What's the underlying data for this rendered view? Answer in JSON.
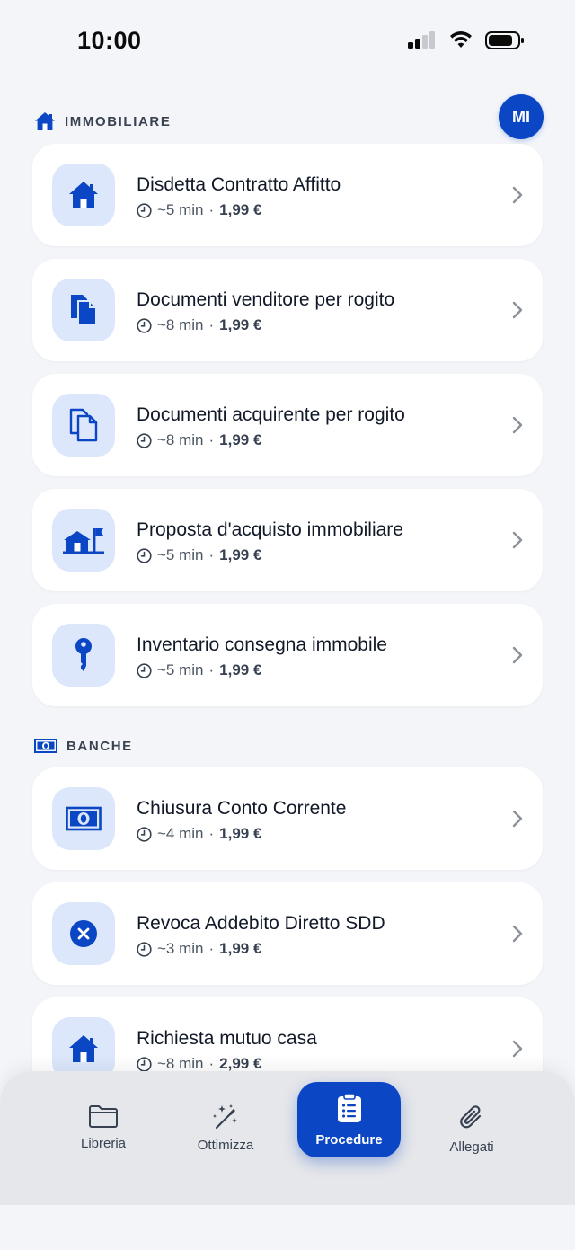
{
  "status_bar": {
    "time": "10:00"
  },
  "user": {
    "initials": "MI"
  },
  "sections": {
    "immobiliare": {
      "title": "IMMOBILIARE",
      "icon": "house-icon",
      "items": [
        {
          "title": "Disdetta Contratto Affitto",
          "duration": "~5 min",
          "separator": "·",
          "price": "1,99 €",
          "icon": "house-icon"
        },
        {
          "title": "Documenti venditore per rogito",
          "duration": "~8 min",
          "separator": "·",
          "price": "1,99 €",
          "icon": "documents-filled-icon"
        },
        {
          "title": "Documenti acquirente per rogito",
          "duration": "~8 min",
          "separator": "·",
          "price": "1,99 €",
          "icon": "documents-outline-icon"
        },
        {
          "title": "Proposta d'acquisto immobiliare",
          "duration": "~5 min",
          "separator": "·",
          "price": "1,99 €",
          "icon": "house-flag-icon"
        },
        {
          "title": "Inventario consegna immobile",
          "duration": "~5 min",
          "separator": "·",
          "price": "1,99 €",
          "icon": "key-icon"
        }
      ]
    },
    "banche": {
      "title": "BANCHE",
      "icon": "banknote-icon",
      "items": [
        {
          "title": "Chiusura Conto Corrente",
          "duration": "~4 min",
          "separator": "·",
          "price": "1,99 €",
          "icon": "banknote-icon"
        },
        {
          "title": "Revoca Addebito Diretto SDD",
          "duration": "~3 min",
          "separator": "·",
          "price": "1,99 €",
          "icon": "x-circle-icon"
        },
        {
          "title": "Richiesta mutuo casa",
          "duration": "~8 min",
          "separator": "·",
          "price": "2,99 €",
          "icon": "house-icon"
        }
      ]
    }
  },
  "tab_bar": {
    "tabs": [
      {
        "label": "Libreria",
        "icon": "folder-icon",
        "active": false
      },
      {
        "label": "Ottimizza",
        "icon": "magic-wand-icon",
        "active": false
      },
      {
        "label": "Procedure",
        "icon": "clipboard-list-icon",
        "active": true
      },
      {
        "label": "Allegati",
        "icon": "paperclip-icon",
        "active": false
      }
    ]
  },
  "colors": {
    "accent": "#0b47c4",
    "icon_tile": "#dce7fb",
    "background": "#f3f5f9",
    "card": "#ffffff",
    "tab_bar": "#e6e7ea"
  }
}
